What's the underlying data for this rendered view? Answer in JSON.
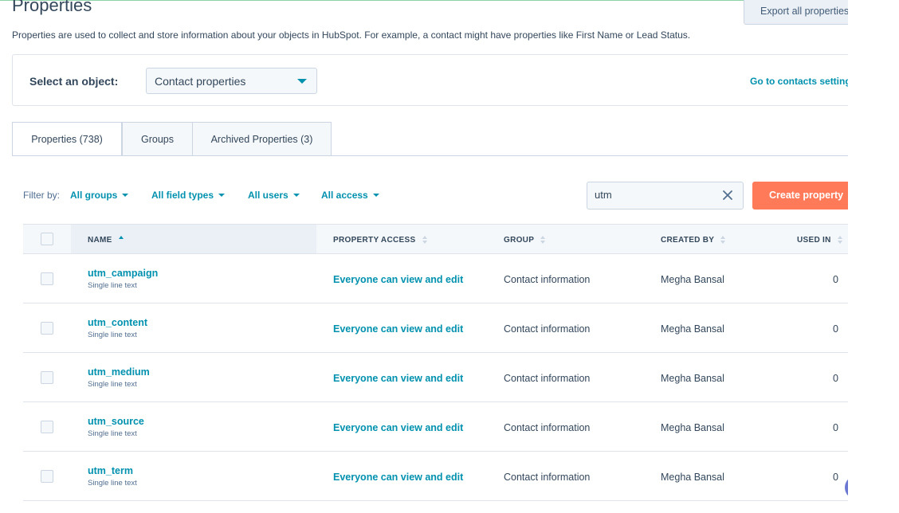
{
  "page": {
    "title": "Properties",
    "description": "Properties are used to collect and store information about your objects in HubSpot. For example, a contact might have properties like First Name or Lead Status.",
    "export_label": "Export all properties"
  },
  "object_selector": {
    "label": "Select an object:",
    "value": "Contact properties",
    "settings_link": "Go to contacts settings"
  },
  "tabs": [
    {
      "label": "Properties (738)",
      "active": true
    },
    {
      "label": "Groups",
      "active": false
    },
    {
      "label": "Archived Properties (3)",
      "active": false
    }
  ],
  "filters": {
    "label": "Filter by:",
    "items": [
      "All groups",
      "All field types",
      "All users",
      "All access"
    ]
  },
  "search": {
    "value": "utm"
  },
  "create_label": "Create property",
  "table": {
    "columns": [
      "NAME",
      "PROPERTY ACCESS",
      "GROUP",
      "CREATED BY",
      "USED IN"
    ],
    "sorted_column": "NAME",
    "rows": [
      {
        "name": "utm_campaign",
        "type": "Single line text",
        "access": "Everyone can view and edit",
        "group": "Contact information",
        "created_by": "Megha Bansal",
        "used_in": "0"
      },
      {
        "name": "utm_content",
        "type": "Single line text",
        "access": "Everyone can view and edit",
        "group": "Contact information",
        "created_by": "Megha Bansal",
        "used_in": "0"
      },
      {
        "name": "utm_medium",
        "type": "Single line text",
        "access": "Everyone can view and edit",
        "group": "Contact information",
        "created_by": "Megha Bansal",
        "used_in": "0"
      },
      {
        "name": "utm_source",
        "type": "Single line text",
        "access": "Everyone can view and edit",
        "group": "Contact information",
        "created_by": "Megha Bansal",
        "used_in": "0"
      },
      {
        "name": "utm_term",
        "type": "Single line text",
        "access": "Everyone can view and edit",
        "group": "Contact information",
        "created_by": "Megha Bansal",
        "used_in": "0"
      }
    ]
  },
  "colors": {
    "accent_link": "#0091ae",
    "primary_button": "#ff7a59",
    "text": "#33475b",
    "border": "#cbd6e2",
    "header_bg": "#f5f8fa"
  },
  "icons": {
    "dropdown": "caret-down-icon",
    "clear_search": "close-icon",
    "sort_active": "sort-ascending-icon",
    "sort": "sort-icon"
  }
}
